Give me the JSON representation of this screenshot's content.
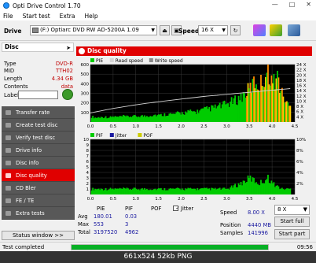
{
  "window": {
    "title": "Opti Drive Control 1.70"
  },
  "menu": [
    "File",
    "Start test",
    "Extra",
    "Help"
  ],
  "drivebar": {
    "drive_label": "Drive",
    "drive_value": "(F:)   Optiarc DVD RW AD-5200A 1.09",
    "speed_label": "Speed",
    "speed_value": "16 X"
  },
  "disc": {
    "header": "Disc",
    "rows": [
      {
        "key": "Type",
        "value": "DVD-R"
      },
      {
        "key": "MID",
        "value": "TTH02"
      },
      {
        "key": "Length",
        "value": "4.34 GB"
      },
      {
        "key": "Contents",
        "value": "data"
      }
    ],
    "label_key": "Label"
  },
  "nav": [
    "Transfer rate",
    "Create test disc",
    "Verify test disc",
    "Drive info",
    "Disc info",
    "Disc quality",
    "CD Bler",
    "FE / TE",
    "Extra tests"
  ],
  "nav_active_index": 5,
  "status_window_label": "Status window >>",
  "panel_title": "Disc quality",
  "colors": {
    "accent": "#e00000",
    "pie": "#00cc00",
    "pif": "#00cc00",
    "read_speed": "#d4d4d4",
    "progress": "#06b025"
  },
  "chart_data": [
    {
      "type": "bar",
      "legend": [
        "PIE",
        "Read speed",
        "Write speed"
      ],
      "y_left_ticks": [
        100,
        200,
        300,
        400,
        500,
        600
      ],
      "y_right_ticks": [
        "4 X",
        "6 X",
        "8 X",
        "10 X",
        "12 X",
        "14 X",
        "16 X",
        "18 X",
        "20 X",
        "22 X",
        "24 X"
      ],
      "x_ticks": [
        0.0,
        0.5,
        1.0,
        1.5,
        2.0,
        2.5,
        3.0,
        3.5,
        4.0,
        4.5
      ],
      "xlim": [
        0,
        4.5
      ],
      "ylim": [
        0,
        600
      ],
      "pie_profile": [
        [
          0.0,
          60
        ],
        [
          0.1,
          45
        ],
        [
          0.2,
          50
        ],
        [
          0.3,
          55
        ],
        [
          0.4,
          48
        ],
        [
          0.5,
          58
        ],
        [
          0.6,
          52
        ],
        [
          0.7,
          60
        ],
        [
          0.8,
          55
        ],
        [
          0.9,
          62
        ],
        [
          1.0,
          58
        ],
        [
          1.1,
          65
        ],
        [
          1.2,
          60
        ],
        [
          1.3,
          70
        ],
        [
          1.4,
          75
        ],
        [
          1.5,
          70
        ],
        [
          1.6,
          78
        ],
        [
          1.7,
          85
        ],
        [
          1.8,
          80
        ],
        [
          1.9,
          90
        ],
        [
          2.0,
          95
        ],
        [
          2.1,
          100
        ],
        [
          2.2,
          110
        ],
        [
          2.3,
          105
        ],
        [
          2.4,
          120
        ],
        [
          2.5,
          130
        ],
        [
          2.6,
          140
        ],
        [
          2.7,
          150
        ],
        [
          2.8,
          160
        ],
        [
          2.9,
          175
        ],
        [
          3.0,
          190
        ],
        [
          3.1,
          210
        ],
        [
          3.2,
          230
        ],
        [
          3.3,
          260
        ],
        [
          3.4,
          300
        ],
        [
          3.5,
          350
        ],
        [
          3.6,
          420
        ],
        [
          3.7,
          380
        ],
        [
          3.8,
          450
        ],
        [
          3.9,
          550
        ],
        [
          4.0,
          400
        ],
        [
          4.1,
          480
        ],
        [
          4.2,
          300
        ],
        [
          4.3,
          200
        ],
        [
          4.4,
          150
        ]
      ],
      "read_speed_profile": [
        [
          0.0,
          5.5
        ],
        [
          0.5,
          7.2
        ],
        [
          1.0,
          8.6
        ],
        [
          1.5,
          9.8
        ],
        [
          2.0,
          10.8
        ],
        [
          2.5,
          11.8
        ],
        [
          3.0,
          12.6
        ],
        [
          3.5,
          13.4
        ],
        [
          4.0,
          14.2
        ],
        [
          4.4,
          14.8
        ]
      ]
    },
    {
      "type": "bar",
      "legend": [
        "PIF",
        "Jitter",
        "POF"
      ],
      "y_left_ticks": [
        1,
        2,
        3,
        4,
        5,
        6,
        7,
        8,
        9,
        10
      ],
      "y_right_ticks": [
        "2%",
        "4%",
        "6%",
        "8%",
        "10%"
      ],
      "x_ticks": [
        0.0,
        0.5,
        1.0,
        1.5,
        2.0,
        2.5,
        3.0,
        3.5,
        4.0,
        4.5
      ],
      "xlim": [
        0,
        4.5
      ],
      "ylim": [
        0,
        10
      ],
      "pif_profile": [
        [
          0.0,
          1
        ],
        [
          0.3,
          1
        ],
        [
          0.6,
          1
        ],
        [
          1.0,
          1
        ],
        [
          1.5,
          1
        ],
        [
          2.0,
          1
        ],
        [
          2.5,
          1
        ],
        [
          3.0,
          1
        ],
        [
          3.3,
          2
        ],
        [
          3.5,
          3
        ],
        [
          3.7,
          2
        ],
        [
          3.9,
          3
        ],
        [
          4.0,
          2
        ],
        [
          4.2,
          1
        ],
        [
          4.4,
          1
        ]
      ]
    }
  ],
  "stats": {
    "headers": {
      "pie": "PIE",
      "pif": "PIF",
      "pof": "POF"
    },
    "jitter_label": "Jitter",
    "jitter_checked": "✓",
    "rows": [
      {
        "label": "Avg",
        "pie": "180.01",
        "pif": "0.03",
        "pof": ""
      },
      {
        "label": "Max",
        "pie": "553",
        "pif": "3",
        "pof": ""
      },
      {
        "label": "Total",
        "pie": "3197520",
        "pif": "4962",
        "pof": ""
      }
    ],
    "speed_label": "Speed",
    "speed_value": "8.00 X",
    "position_label": "Position",
    "position_value": "4440 MB",
    "samples_label": "Samples",
    "samples_value": "141996",
    "speed_select": "8 X",
    "start_full": "Start full",
    "start_part": "Start part"
  },
  "statusbar": {
    "text": "Test completed",
    "progress": 1.0,
    "time": "09:56"
  },
  "caption": "661x524  52kb  PNG"
}
